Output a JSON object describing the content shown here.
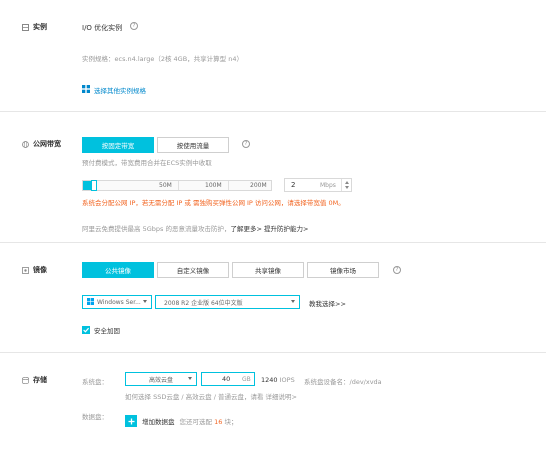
{
  "instance": {
    "section_label": "实例",
    "family_title": "I/O 优化实例",
    "spec_line": "实例规格：ecs.n4.large（2核 4GB，共享计算型 n4）",
    "choose_other_link": "选择其他实例规格"
  },
  "bandwidth": {
    "section_label": "公网带宽",
    "tabs": [
      "按固定带宽",
      "按使用流量"
    ],
    "desc": "预付费模式，带宽费用合并在ECS实例中收取",
    "slider_ticks": [
      "50M",
      "100M",
      "200M"
    ],
    "value": "2",
    "unit": "Mbps",
    "value_fraction": 0.01,
    "warning": "系统会分配公网 IP，若无需分配 IP 或 需独购买弹性公网 IP 访问公网，请选择带宽值 0M。",
    "ddos_text": "阿里云免费提供最高 5Gbps 的恶意流量攻击防护，",
    "ddos_link": "了解更多> 提升防护能力>"
  },
  "image": {
    "section_label": "镜像",
    "tabs": [
      "公共镜像",
      "自定义镜像",
      "共享镜像",
      "镜像市场"
    ],
    "os_select": "Windows Ser...",
    "version_select": "2008 R2 企业版 64位中文版",
    "help_link": "教我选择>>",
    "security_checkbox": "安全加固"
  },
  "storage": {
    "section_label": "存储",
    "system_disk_label": "系统盘：",
    "disk_type": "高效云盘",
    "size_value": "40",
    "size_unit": "GB",
    "iops": "1240",
    "iops_unit": "IOPS",
    "device_label": "系统盘设备名：/dev/xvda",
    "help_text": "如何选择 SSD云盘 / 高效云盘 / 普通云盘，请看 详细说明>",
    "data_disk_label": "数据盘：",
    "add_button": "增加数据盘",
    "remaining_prefix": "您还可选配",
    "remaining_count": "16",
    "remaining_suffix": "块；"
  },
  "colors": {
    "accent": "#00c1de",
    "link": "#0088cc",
    "warning": "#f26522",
    "border": "#e6e6e6"
  },
  "icons": [
    "cube-icon",
    "globe-icon",
    "disc-icon",
    "database-icon",
    "help-icon",
    "grid-icon",
    "windows-icon",
    "check-icon",
    "plus-icon"
  ]
}
